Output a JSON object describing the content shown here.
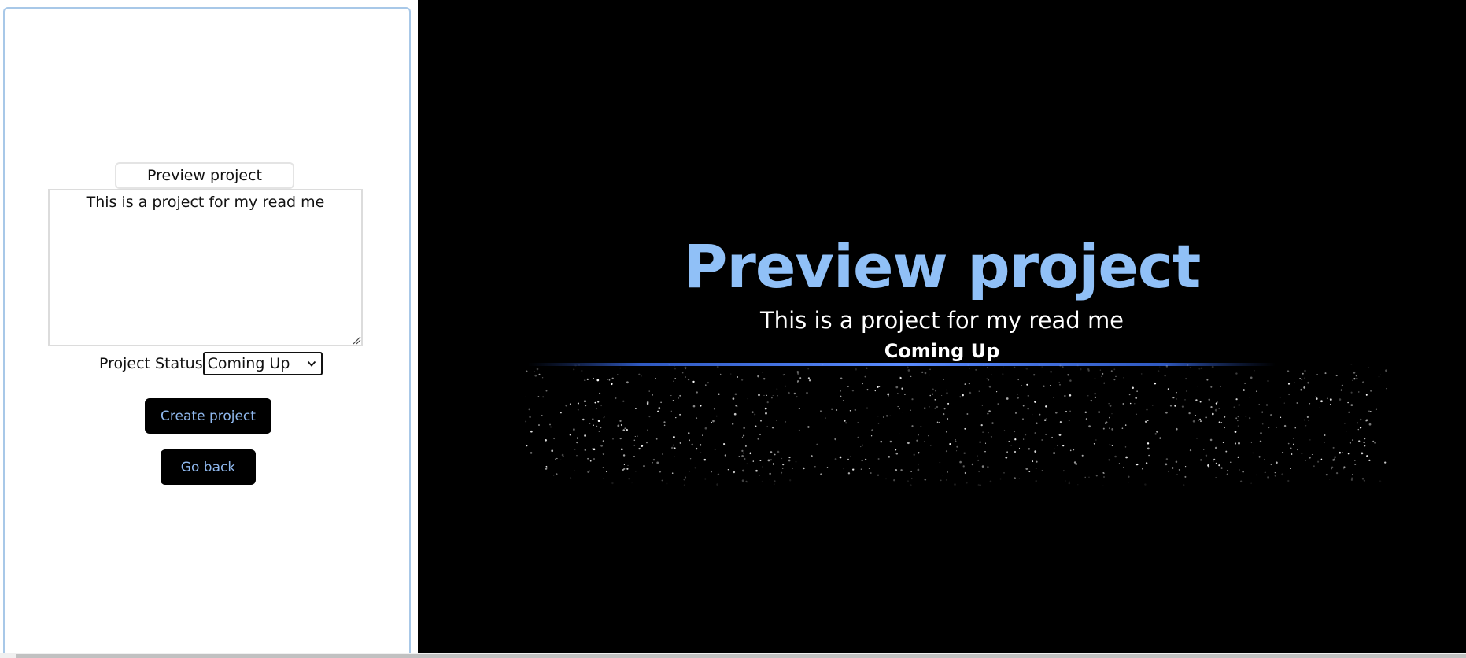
{
  "editor": {
    "title_value": "Preview project",
    "description_value": "This is a project for my read me",
    "status_label": "Project Status",
    "status_selected": "Coming Up",
    "create_button": "Create project",
    "back_button": "Go back"
  },
  "preview": {
    "title": "Preview project",
    "description": "This is a project for my read me",
    "status": "Coming Up"
  },
  "colors": {
    "accent_blue": "#90c0f7",
    "button_text": "#8fb8ee",
    "preview_bg": "#000000"
  }
}
